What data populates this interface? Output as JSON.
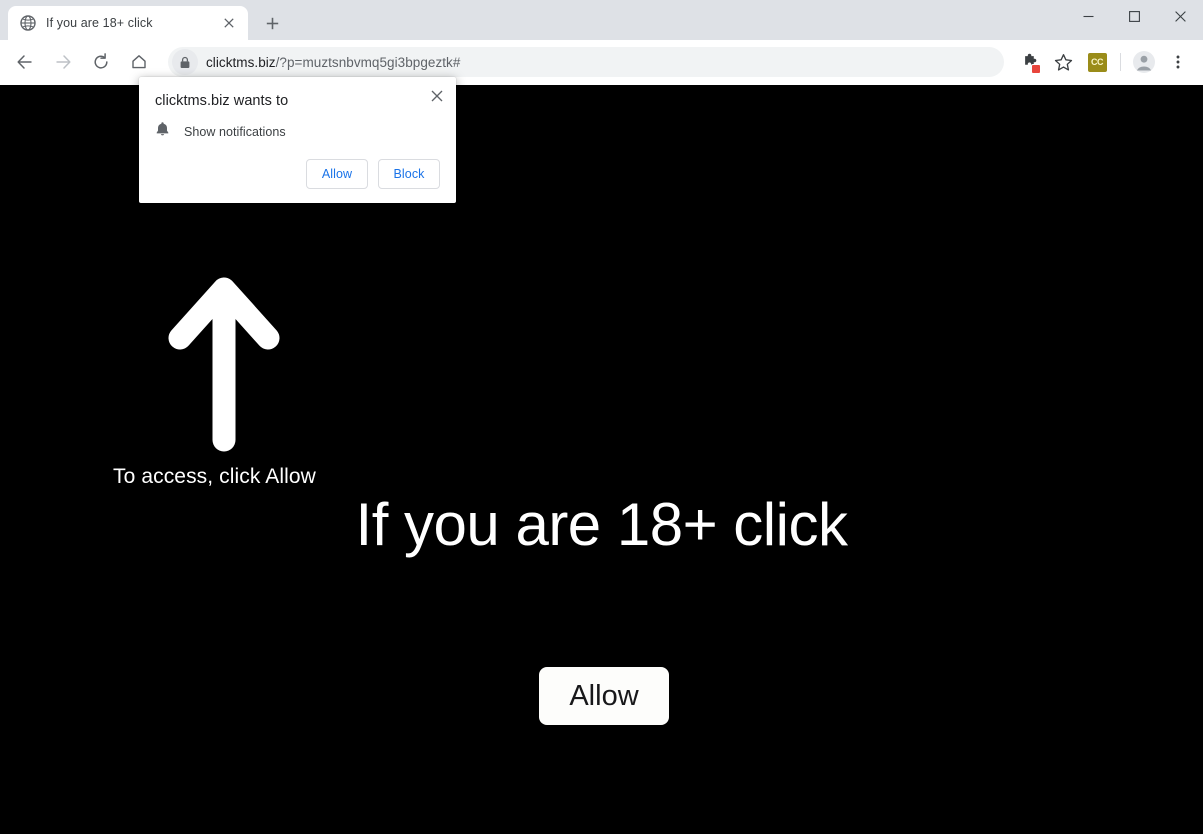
{
  "window": {
    "controls": {
      "minimize": "minimize-icon",
      "maximize": "maximize-icon",
      "close": "close-icon"
    }
  },
  "tabstrip": {
    "tabs": [
      {
        "title": "If you are 18+ click",
        "favicon": "globe-icon",
        "close_label": "close-tab-icon"
      }
    ],
    "new_tab_label": "plus-icon"
  },
  "toolbar": {
    "back": "back-arrow-icon",
    "forward": "forward-arrow-icon",
    "reload": "reload-icon",
    "home": "home-icon",
    "omnibox": {
      "security_icon": "lock-icon",
      "url_host": "clicktms.biz",
      "url_path": "/?p=muztsnbvmq5gi3bpgeztk#",
      "url_full": "clicktms.biz/?p=muztsnbvmq5gi3bpgeztk#"
    },
    "extensions_icon": "puzzle-piece-icon",
    "bookmark_icon": "star-icon",
    "cc_extension_label": "CC",
    "profile_icon": "avatar-icon",
    "menu_icon": "three-dot-menu-icon"
  },
  "permission_bubble": {
    "title": "clicktms.biz wants to",
    "request_icon": "bell-icon",
    "request_label": "Show notifications",
    "allow_label": "Allow",
    "block_label": "Block",
    "close_label": "close-icon",
    "link_color": "#1a73e8"
  },
  "page": {
    "background_color": "#000000",
    "text_color": "#ffffff",
    "arrow_icon": "up-arrow-icon",
    "instruction": "To access, click Allow",
    "headline": "If you are 18+ click",
    "allow_button_label": "Allow"
  }
}
